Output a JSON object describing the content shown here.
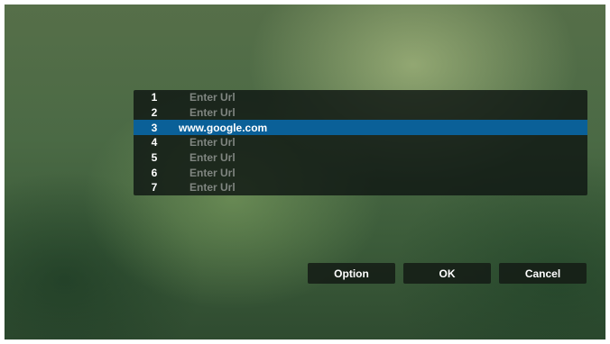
{
  "url_list": {
    "selected_index": 2,
    "items": [
      {
        "number": "1",
        "url": "Enter Url"
      },
      {
        "number": "2",
        "url": "Enter Url"
      },
      {
        "number": "3",
        "url": "www.google.com"
      },
      {
        "number": "4",
        "url": "Enter Url"
      },
      {
        "number": "5",
        "url": "Enter Url"
      },
      {
        "number": "6",
        "url": "Enter Url"
      },
      {
        "number": "7",
        "url": "Enter Url"
      }
    ]
  },
  "buttons": {
    "option_label": "Option",
    "ok_label": "OK",
    "cancel_label": "Cancel"
  },
  "colors": {
    "selection": "#0a6098",
    "placeholder_text": "#7f8580"
  }
}
